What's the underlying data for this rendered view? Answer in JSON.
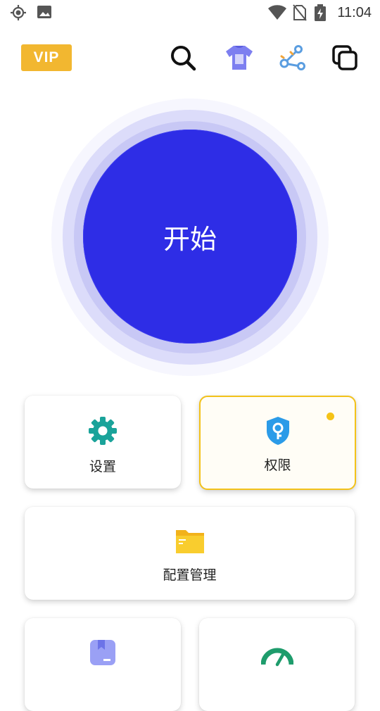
{
  "status_bar": {
    "time": "11:04",
    "icons": [
      "gps-icon",
      "image-icon",
      "wifi-icon",
      "no-sim-icon",
      "battery-charging-icon"
    ]
  },
  "header": {
    "vip_label": "VIP",
    "icons": [
      "search-icon",
      "tshirt-icon",
      "share-icon",
      "copy-icon"
    ]
  },
  "main": {
    "start_label": "开始"
  },
  "cards": {
    "settings": {
      "label": "设置",
      "icon": "gear-icon"
    },
    "permissions": {
      "label": "权限",
      "icon": "shield-key-icon",
      "badge_color": "#f5c317"
    },
    "config": {
      "label": "配置管理",
      "icon": "folder-icon"
    },
    "bottom_left": {
      "icon": "bookmark-icon"
    },
    "bottom_right": {
      "icon": "speedometer-icon"
    }
  },
  "colors": {
    "primary": "#2e2de6",
    "vip": "#f2b730",
    "accent_yellow": "#f3c21a"
  }
}
